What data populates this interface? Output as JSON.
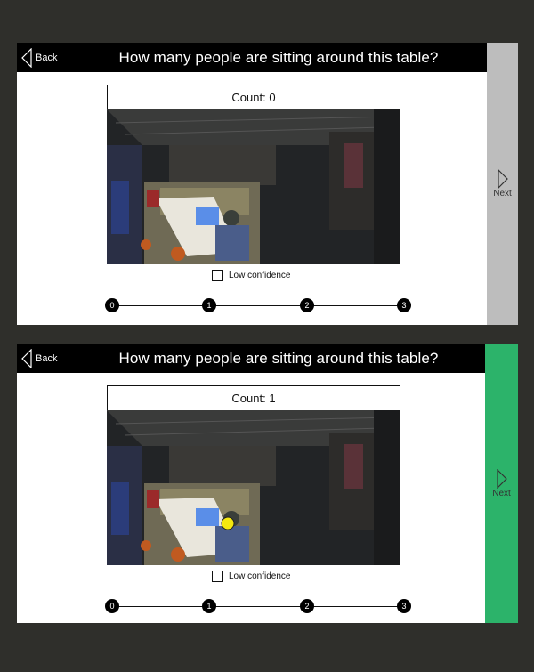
{
  "panels": [
    {
      "back_label": "Back",
      "question": "How many people are sitting around this table?",
      "count_text": "Count: 0",
      "low_confidence_label": "Low confidence",
      "next_label": "Next",
      "next_color": "#bdbdbd",
      "slider": [
        "0",
        "1",
        "2",
        "3"
      ],
      "marker": false
    },
    {
      "back_label": "Back",
      "question": "How many people are sitting around this table?",
      "count_text": "Count: 1",
      "low_confidence_label": "Low confidence",
      "next_label": "Next",
      "next_color": "#2cb36a",
      "slider": [
        "0",
        "1",
        "2",
        "3"
      ],
      "marker": true,
      "marker_color": "#f5e80f"
    }
  ]
}
